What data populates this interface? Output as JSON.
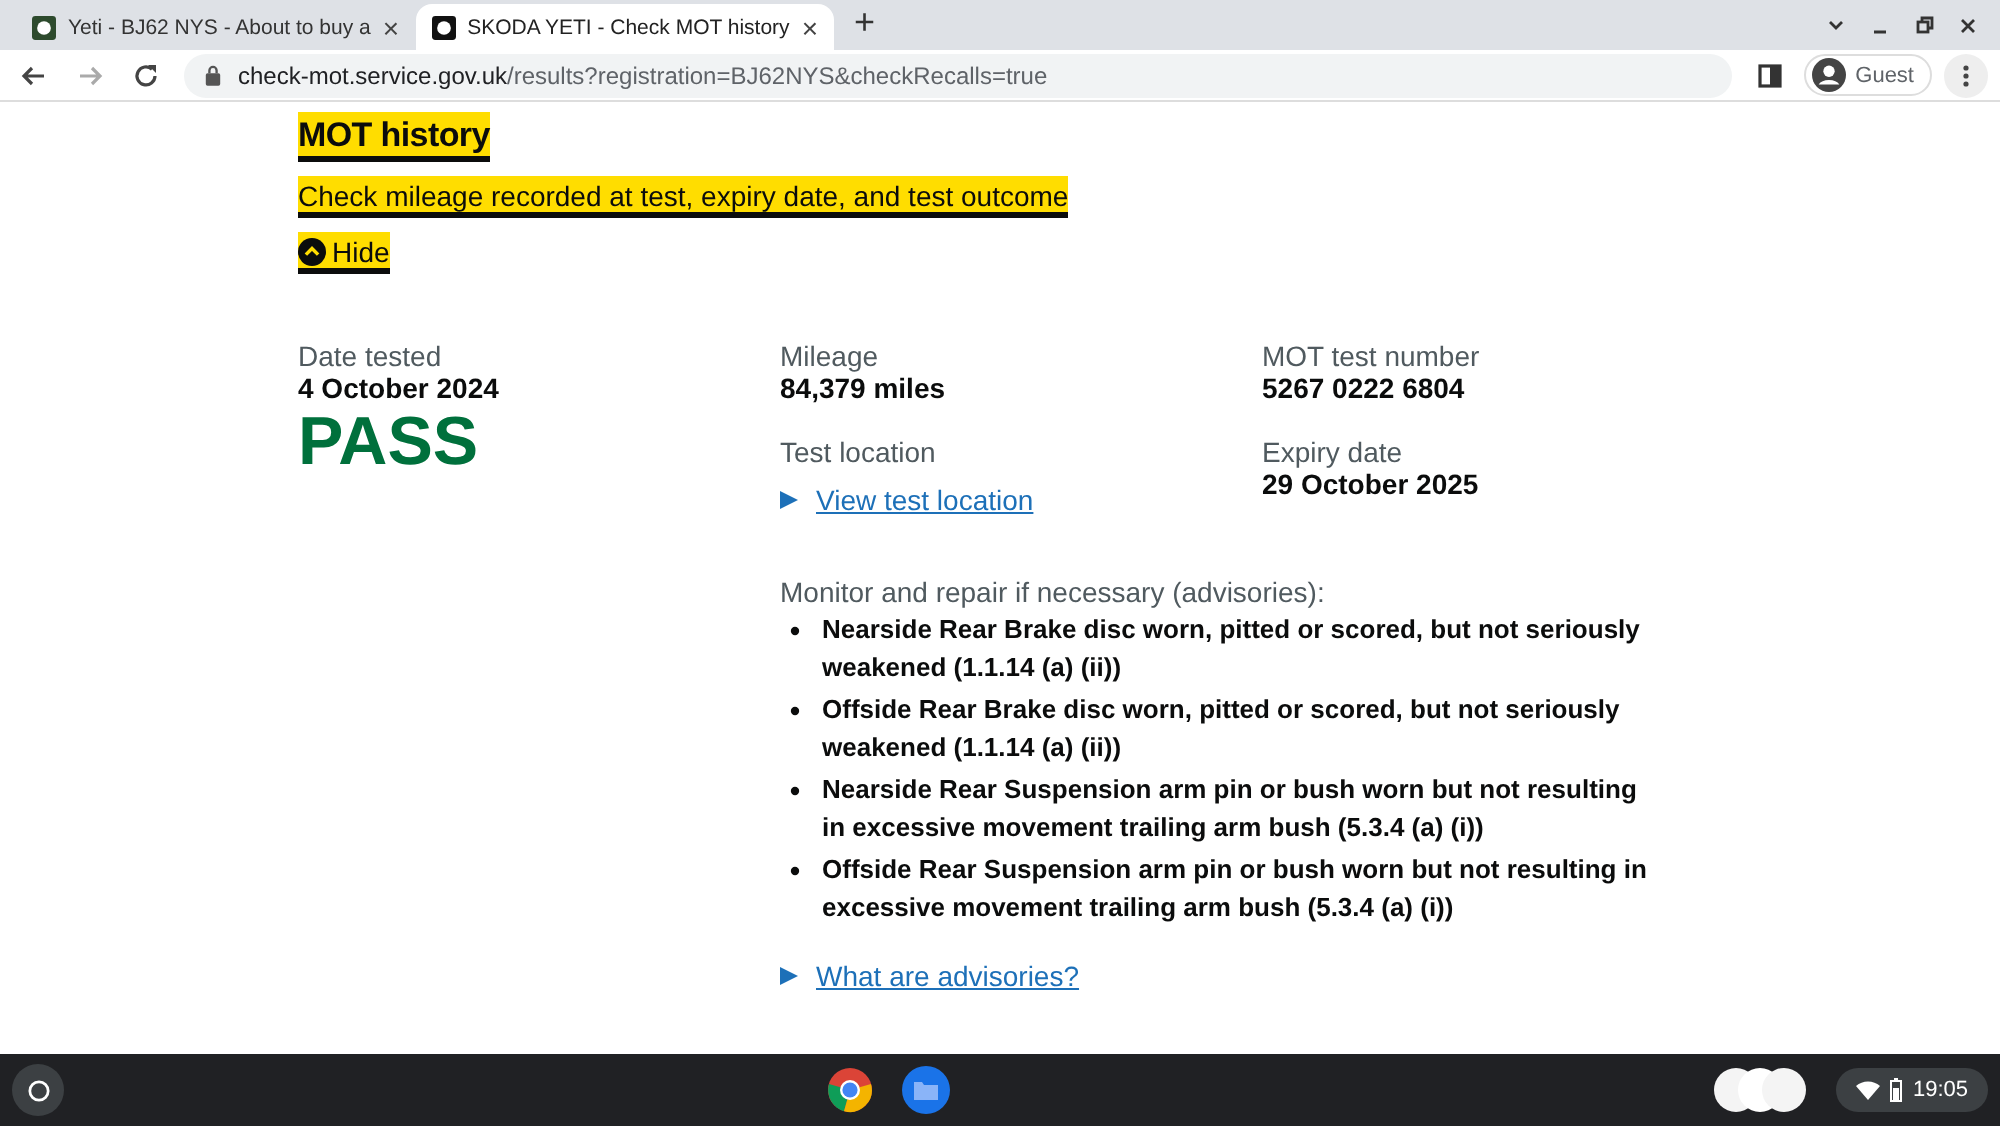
{
  "browser": {
    "tabs": [
      {
        "title": "Yeti - BJ62 NYS - About to buy a",
        "selected": false,
        "close": "×"
      },
      {
        "title": "SKODA YETI - Check MOT history",
        "selected": true,
        "close": "×"
      }
    ],
    "new_tab": "+",
    "url_host": "check-mot.service.gov.uk",
    "url_path": "/results?registration=BJ62NYS&checkRecalls=true",
    "profile": "Guest"
  },
  "section": {
    "title": "MOT history",
    "subtitle": "Check mileage recorded at test, expiry date, and test outcome",
    "toggle": "Hide",
    "expanded": true
  },
  "test": {
    "date_label": "Date tested",
    "date": "4 October 2024",
    "result": "PASS",
    "mileage_label": "Mileage",
    "mileage": "84,379 miles",
    "location_label": "Test location",
    "location_link": "View test location",
    "number_label": "MOT test number",
    "number": "5267 0222 6804",
    "expiry_label": "Expiry date",
    "expiry": "29 October 2025",
    "advisories_label": "Monitor and repair if necessary (advisories):",
    "advisories": [
      "Nearside Rear Brake disc worn, pitted or scored, but not seriously weakened (1.1.14 (a) (ii))",
      "Offside Rear Brake disc worn, pitted or scored, but not seriously weakened (1.1.14 (a) (ii))",
      "Nearside Rear Suspension arm pin or bush worn but not resulting in excessive movement trailing arm bush (5.3.4 (a) (i))",
      "Offside Rear Suspension arm pin or bush worn but not resulting in excessive movement trailing arm bush (5.3.4 (a) (i))"
    ],
    "advisories_link": "What are advisories?"
  },
  "shelf": {
    "time": "19:05"
  }
}
